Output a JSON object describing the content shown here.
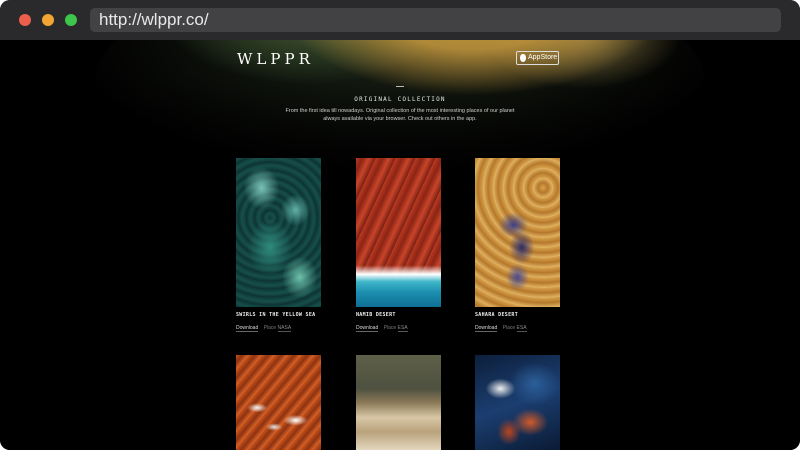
{
  "browser": {
    "url": "http://wlppr.co/",
    "traffic_lights": {
      "close": "#ec5f4b",
      "minimize": "#f2a531",
      "zoom": "#3ec54c"
    }
  },
  "header": {
    "logo": "WLPPR",
    "appstore_label": "AppStore"
  },
  "intro": {
    "title": "ORIGINAL COLLECTION",
    "description_line1": "From the first idea till nowadays. Original collection of the most interesting places of our planet",
    "description_line2": "always available via your browser. Check out others in the app."
  },
  "cards": [
    {
      "title": "SWIRLS IN THE YELLOW SEA",
      "download": "Download",
      "place_label": "Place",
      "source": "NASA"
    },
    {
      "title": "NAMIB DESERT",
      "download": "Download",
      "place_label": "Place",
      "source": "ESA"
    },
    {
      "title": "SAHARA DESERT",
      "download": "Download",
      "place_label": "Place",
      "source": "ESA"
    }
  ]
}
